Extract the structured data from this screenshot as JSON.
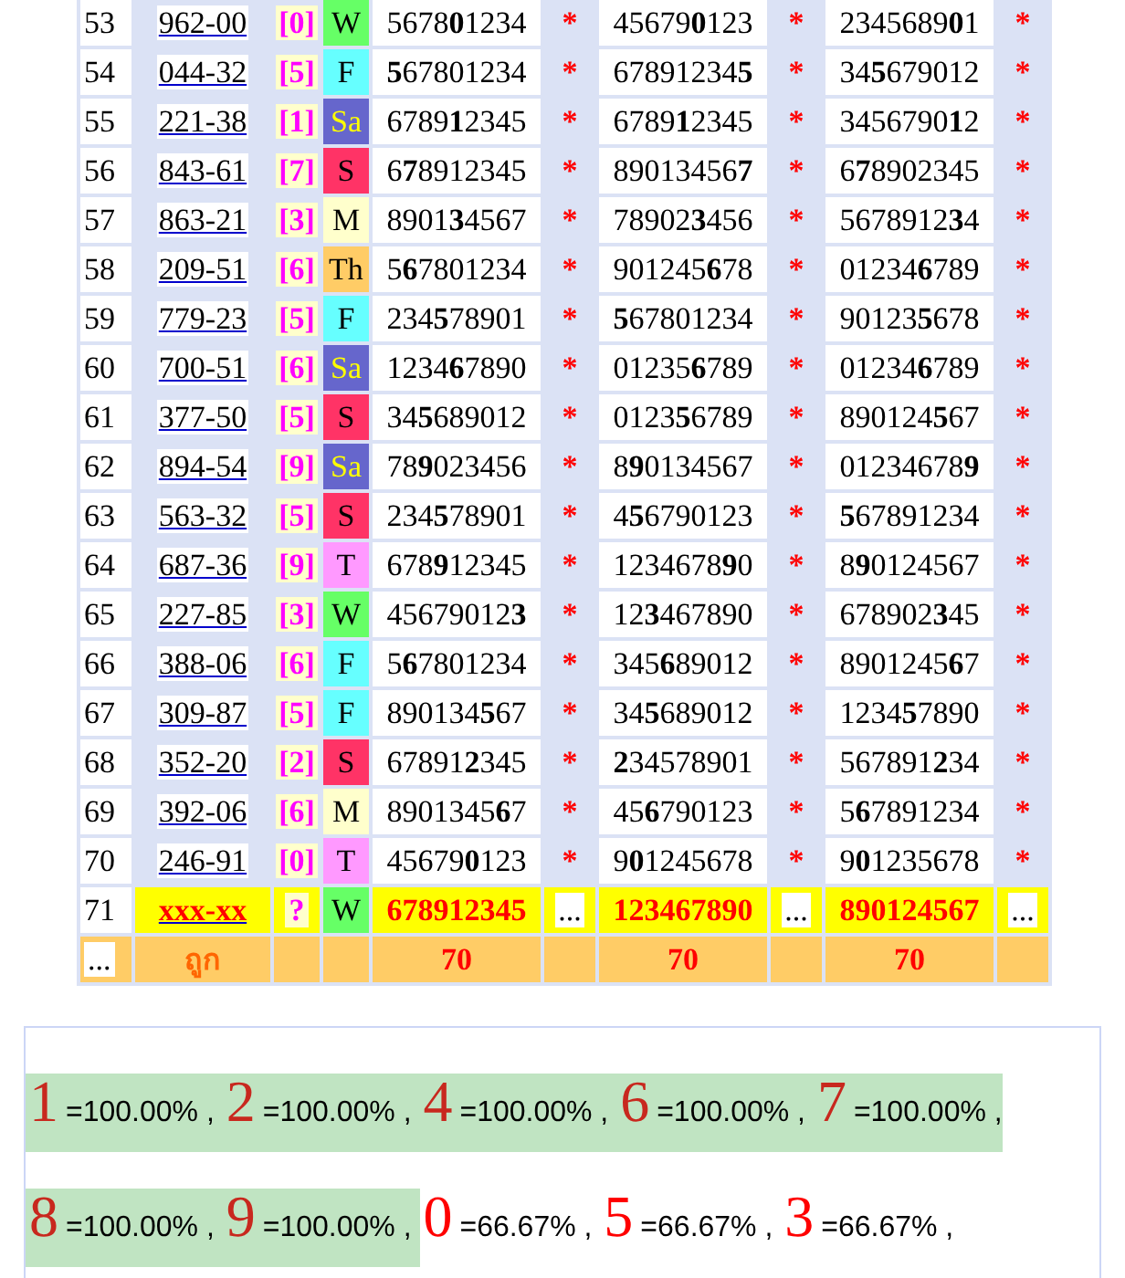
{
  "rows": [
    {
      "no": "53",
      "code": "962-00",
      "digit": "[0]",
      "day": "W",
      "color": "#66ff66",
      "numbers": [
        "5678**0**1234",
        "45679**0**123",
        "2345689**0**1"
      ],
      "marks": [
        "*",
        "*",
        "*"
      ],
      "highlighted": false
    },
    {
      "no": "54",
      "code": "044-32",
      "digit": "[5]",
      "day": "F",
      "color": "#66ffff",
      "numbers": [
        "**5**67801234",
        "67891234**5**",
        "34**5**679012"
      ],
      "marks": [
        "*",
        "*",
        "*"
      ],
      "highlighted": false
    },
    {
      "no": "55",
      "code": "221-38",
      "digit": "[1]",
      "day": "Sa",
      "color": "#6666cc",
      "numbers": [
        "6789**1**2345",
        "6789**1**2345",
        "3456790**1**2"
      ],
      "marks": [
        "*",
        "*",
        "*"
      ],
      "highlighted": false
    },
    {
      "no": "56",
      "code": "843-61",
      "digit": "[7]",
      "day": "S",
      "color": "#ff3366",
      "numbers": [
        "6**7**8912345",
        "89013456**7**",
        "6**7**8902345"
      ],
      "marks": [
        "*",
        "*",
        "*"
      ],
      "highlighted": false
    },
    {
      "no": "57",
      "code": "863-21",
      "digit": "[3]",
      "day": "M",
      "color": "#ffffcc",
      "numbers": [
        "8901**3**4567",
        "78902**3**456",
        "5678912**3**4"
      ],
      "marks": [
        "*",
        "*",
        "*"
      ],
      "highlighted": false
    },
    {
      "no": "58",
      "code": "209-51",
      "digit": "[6]",
      "day": "Th",
      "color": "#ffcc66",
      "numbers": [
        "5**6**7801234",
        "901245**6**78",
        "01234**6**789"
      ],
      "marks": [
        "*",
        "*",
        "*"
      ],
      "highlighted": false
    },
    {
      "no": "59",
      "code": "779-23",
      "digit": "[5]",
      "day": "F",
      "color": "#66ffff",
      "numbers": [
        "234**5**78901",
        "**5**67801234",
        "90123**5**678"
      ],
      "marks": [
        "*",
        "*",
        "*"
      ],
      "highlighted": false
    },
    {
      "no": "60",
      "code": "700-51",
      "digit": "[6]",
      "day": "Sa",
      "color": "#6666cc",
      "numbers": [
        "1234**6**7890",
        "01235**6**789",
        "01234**6**789"
      ],
      "marks": [
        "*",
        "*",
        "*"
      ],
      "highlighted": false
    },
    {
      "no": "61",
      "code": "377-50",
      "digit": "[5]",
      "day": "S",
      "color": "#ff3366",
      "numbers": [
        "34**5**689012",
        "0123**5**6789",
        "890124**5**67"
      ],
      "marks": [
        "*",
        "*",
        "*"
      ],
      "highlighted": false
    },
    {
      "no": "62",
      "code": "894-54",
      "digit": "[9]",
      "day": "Sa",
      "color": "#6666cc",
      "numbers": [
        "78**9**023456",
        "8**9**0134567",
        "01234678**9**"
      ],
      "marks": [
        "*",
        "*",
        "*"
      ],
      "highlighted": false
    },
    {
      "no": "63",
      "code": "563-32",
      "digit": "[5]",
      "day": "S",
      "color": "#ff3366",
      "numbers": [
        "234**5**78901",
        "4**5**6790123",
        "**5**67891234"
      ],
      "marks": [
        "*",
        "*",
        "*"
      ],
      "highlighted": false
    },
    {
      "no": "64",
      "code": "687-36",
      "digit": "[9]",
      "day": "T",
      "color": "#ff99ff",
      "numbers": [
        "678**9**12345",
        "1234678**9**0",
        "8**9**0124567"
      ],
      "marks": [
        "*",
        "*",
        "*"
      ],
      "highlighted": false
    },
    {
      "no": "65",
      "code": "227-85",
      "digit": "[3]",
      "day": "W",
      "color": "#66ff66",
      "numbers": [
        "45679012**3**",
        "12**3**467890",
        "678902**3**45"
      ],
      "marks": [
        "*",
        "*",
        "*"
      ],
      "highlighted": false
    },
    {
      "no": "66",
      "code": "388-06",
      "digit": "[6]",
      "day": "F",
      "color": "#66ffff",
      "numbers": [
        "5**6**7801234",
        "345**6**89012",
        "8901245**6**7"
      ],
      "marks": [
        "*",
        "*",
        "*"
      ],
      "highlighted": false
    },
    {
      "no": "67",
      "code": "309-87",
      "digit": "[5]",
      "day": "F",
      "color": "#66ffff",
      "numbers": [
        "890134**5**67",
        "34**5**689012",
        "1234**5**7890"
      ],
      "marks": [
        "*",
        "*",
        "*"
      ],
      "highlighted": false
    },
    {
      "no": "68",
      "code": "352-20",
      "digit": "[2]",
      "day": "S",
      "color": "#ff3366",
      "numbers": [
        "67891**2**345",
        "**2**34578901",
        "567891**2**34"
      ],
      "marks": [
        "*",
        "*",
        "*"
      ],
      "highlighted": false
    },
    {
      "no": "69",
      "code": "392-06",
      "digit": "[6]",
      "day": "M",
      "color": "#ffffcc",
      "numbers": [
        "8901345**6**7",
        "45**6**790123",
        "5**6**7891234"
      ],
      "marks": [
        "*",
        "*",
        "*"
      ],
      "highlighted": false
    },
    {
      "no": "70",
      "code": "246-91",
      "digit": "[0]",
      "day": "T",
      "color": "#ff99ff",
      "numbers": [
        "45679**0**123",
        "9**0**1245678",
        "9**0**1235678"
      ],
      "marks": [
        "*",
        "*",
        "*"
      ],
      "highlighted": false
    },
    {
      "no": "71",
      "code": "xxx-xx",
      "digit": "?",
      "day": "W",
      "color": "#66ff66",
      "numbers": [
        "678912345",
        "123467890",
        "890124567"
      ],
      "marks": [
        "...",
        "...",
        "..."
      ],
      "highlighted": true
    }
  ],
  "footer": {
    "first": "...",
    "label": "ถูก",
    "counts": [
      "70",
      "70",
      "70"
    ]
  },
  "legend": [
    {
      "digit": "1",
      "value": "=100.00% ,",
      "hit": true
    },
    {
      "digit": "2",
      "value": "=100.00% ,",
      "hit": true
    },
    {
      "digit": "4",
      "value": "=100.00% ,",
      "hit": true
    },
    {
      "digit": "6",
      "value": "=100.00% ,",
      "hit": true
    },
    {
      "digit": "7",
      "value": "=100.00% ,",
      "hit": true
    },
    {
      "digit": "8",
      "value": "=100.00% ,",
      "hit": true
    },
    {
      "digit": "9",
      "value": "=100.00% ,",
      "hit": true
    },
    {
      "digit": "0",
      "value": "=66.67% ,",
      "hit": false
    },
    {
      "digit": "5",
      "value": "=66.67% ,",
      "hit": false
    },
    {
      "digit": "3",
      "value": "=66.67% ,",
      "hit": false
    }
  ]
}
